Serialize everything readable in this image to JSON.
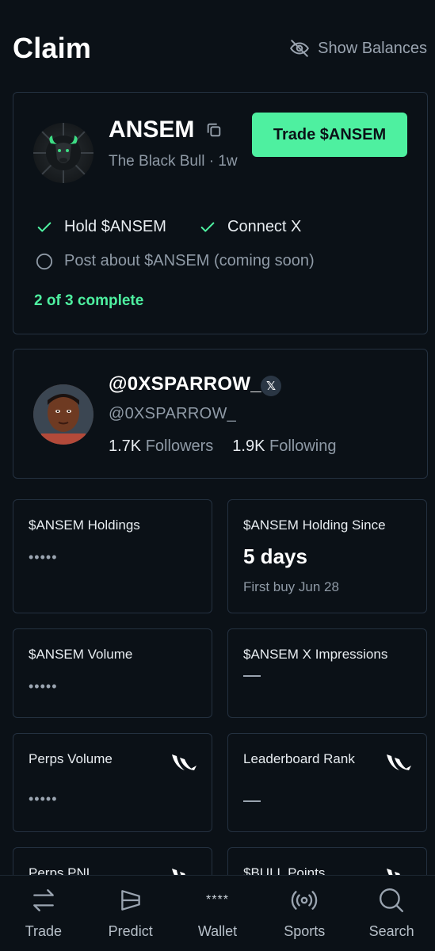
{
  "header": {
    "title": "Claim",
    "show_balances_label": "Show Balances"
  },
  "claim_card": {
    "token_name": "ANSEM",
    "token_subtitle": "The Black Bull · 1w",
    "trade_button": "Trade $ANSEM",
    "tasks": [
      {
        "label": "Hold $ANSEM",
        "done": true
      },
      {
        "label": "Connect X",
        "done": true
      },
      {
        "label": "Post about $ANSEM (coming soon)",
        "done": false
      }
    ],
    "progress": "2 of 3 complete"
  },
  "profile": {
    "display_name": "@0XSPARROW_",
    "handle": "@0XSPARROW_",
    "badge": "𝕏",
    "followers_count": "1.7K",
    "followers_label": "Followers",
    "following_count": "1.9K",
    "following_label": "Following"
  },
  "stats": [
    {
      "label": "$ANSEM Holdings",
      "value": "•••••"
    },
    {
      "label": "$ANSEM Holding Since",
      "value": "5 days",
      "sub": "First buy Jun 28"
    },
    {
      "label": "$ANSEM Volume",
      "value": "•••••"
    },
    {
      "label": "$ANSEM X Impressions",
      "value": "—"
    },
    {
      "label": "Perps Volume",
      "value": "•••••",
      "icon": "wing-logo-icon"
    },
    {
      "label": "Leaderboard Rank",
      "value": "—",
      "icon": "wing-logo-icon"
    },
    {
      "label": "Perps PNL",
      "icon": "wing-logo-icon"
    },
    {
      "label": "$BULL Points",
      "icon": "wing-logo-icon"
    }
  ],
  "nav": {
    "items": [
      {
        "label": "Trade",
        "icon": "swap-arrows-icon"
      },
      {
        "label": "Predict",
        "icon": "predict-icon"
      },
      {
        "label": "Wallet",
        "icon": "masked-balance-icon",
        "glyph": "****"
      },
      {
        "label": "Sports",
        "icon": "broadcast-icon"
      },
      {
        "label": "Search",
        "icon": "search-icon"
      }
    ]
  },
  "colors": {
    "background": "#0b1117",
    "accent": "#4ef0a0",
    "card_border": "#243140",
    "muted_text": "#8f9aa6"
  }
}
